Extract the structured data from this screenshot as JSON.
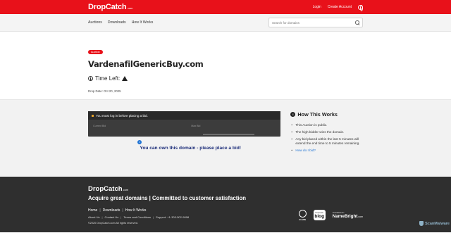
{
  "brand": {
    "name": "DropCatch",
    "suffix": ".com"
  },
  "topbar": {
    "login": "Login",
    "create_account": "Create Account",
    "language_icon": "globe-icon"
  },
  "nav": {
    "items": [
      "Auctions",
      "Downloads",
      "How It Works"
    ],
    "search_placeholder": "Search for domains"
  },
  "listing": {
    "badge": "Auction",
    "domain": "VardenafilGenericBuy.com",
    "time_left_label": "Time Left:",
    "drop_date": "Drop Date: Oct 20, 2025"
  },
  "bid": {
    "login_message": "You must log in before placing a bid.",
    "current_bid_label": "Current Bid",
    "max_bid_label": "Max Bid",
    "own_message": "You can own this domain - please place a bid!"
  },
  "how_it_works": {
    "title": "How This Works",
    "items": [
      "This Auction is public.",
      "The high bidder wins the domain.",
      "Any bid placed within the last 5 minutes will extend the end time to 5 minutes remaining.",
      "How do I bid?"
    ]
  },
  "footer": {
    "tagline": "Acquire great domains | Committed to customer satisfaction",
    "links": [
      "Home",
      "Downloads",
      "How It Works"
    ],
    "small_links": [
      "About Us",
      "Contact Us",
      "Terms and Conditions",
      "Support: +1-303-502-9098"
    ],
    "copyright": "©2020 DropCatch.com All rights reserved.",
    "partners": {
      "icann": "ICANN",
      "blog_top": "DropCatch",
      "blog": "blog",
      "nomebright_top": "POWERED BY",
      "nomebright": "NameBright",
      "nomebright_suffix": ".com"
    }
  },
  "watermark": "ScanMalware",
  "colors": {
    "brand_red": "#e8111a",
    "footer_bg": "#2f2f2f",
    "link_blue": "#1f73d4",
    "own_msg": "#1d2e7a"
  }
}
